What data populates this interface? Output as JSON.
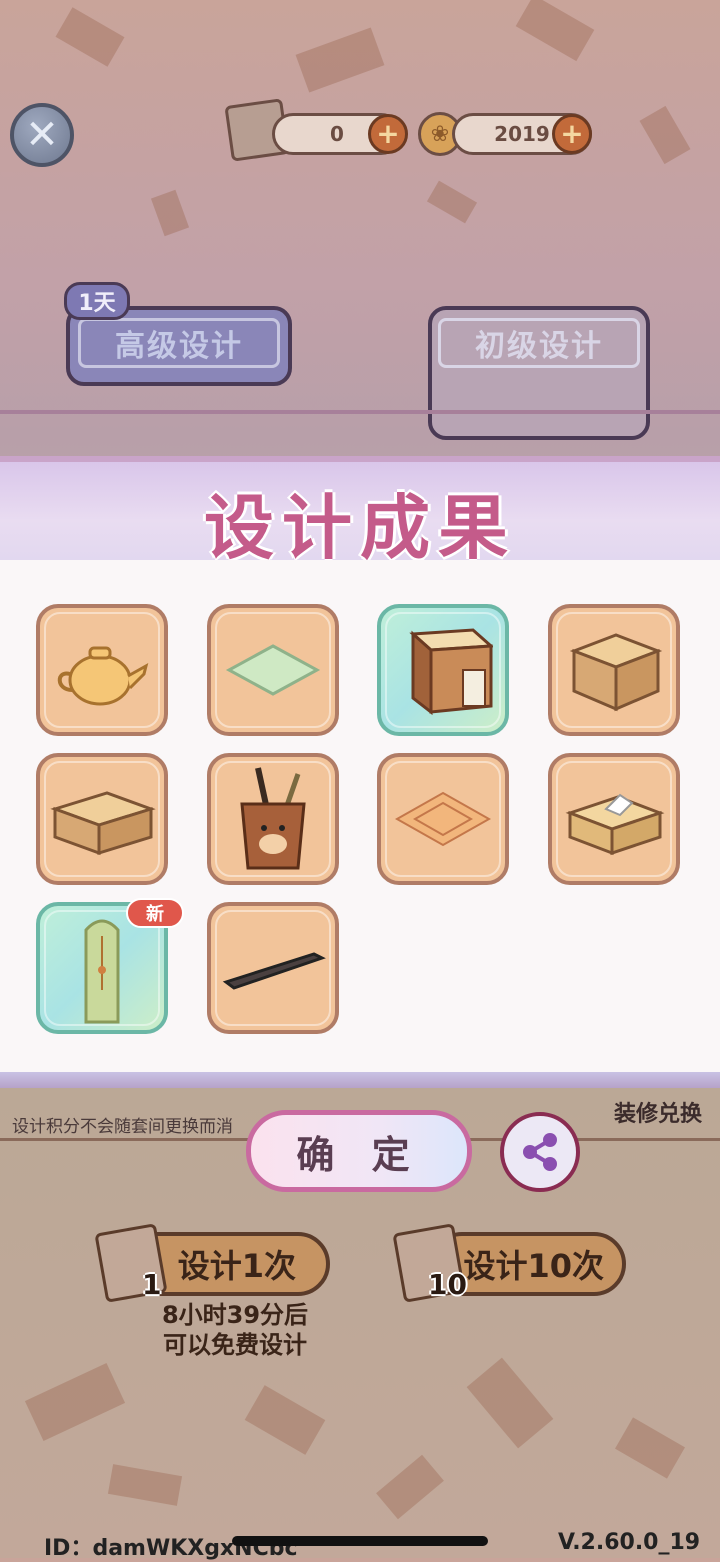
{
  "topbar": {
    "close_icon": "close-icon",
    "scroll_count": "0",
    "coin_count": "2019",
    "plus_label": "+"
  },
  "tabs": {
    "advanced": {
      "label": "高级设计",
      "badge": "1天"
    },
    "basic": {
      "label": "初级设计"
    }
  },
  "result_panel": {
    "title": "设计成果",
    "items": [
      {
        "name": "teapot",
        "rarity": "normal"
      },
      {
        "name": "green-rug",
        "rarity": "normal"
      },
      {
        "name": "wooden-cabinet",
        "rarity": "rare"
      },
      {
        "name": "cardboard-box",
        "rarity": "normal"
      },
      {
        "name": "cardboard-box-flat",
        "rarity": "normal"
      },
      {
        "name": "pen-holder",
        "rarity": "normal"
      },
      {
        "name": "square-rug",
        "rarity": "normal"
      },
      {
        "name": "tissue-box",
        "rarity": "normal"
      },
      {
        "name": "tall-screen",
        "rarity": "rare",
        "badge": "新"
      },
      {
        "name": "dark-plank",
        "rarity": "normal"
      }
    ]
  },
  "bottom": {
    "hint": "设计积分不会随套间更换而消",
    "redeem": "装修兑换",
    "confirm": "确 定",
    "share_icon": "share-icon",
    "draw_once": {
      "label": "设计1次",
      "cost": "1"
    },
    "draw_ten": {
      "label": "设计10次",
      "cost": "10"
    },
    "free_timer_line1": "8小时39分后",
    "free_timer_line2": "可以免费设计"
  },
  "footer": {
    "id": "ID：damWKXgxNCbc",
    "version": "V.2.60.0_19"
  },
  "colors": {
    "accent_pink": "#c45b8a",
    "tab_text": "#c5c9e6",
    "item_border": "#b07c66",
    "rare_border": "#6bb7a6"
  }
}
